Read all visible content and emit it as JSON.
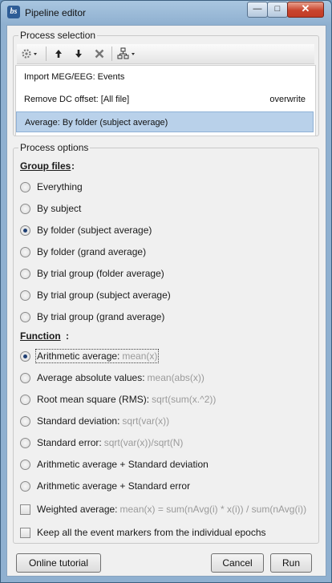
{
  "window": {
    "title": "Pipeline editor",
    "app_icon_text": "bs",
    "controls": {
      "minimize": "—",
      "maximize": "□",
      "close": "✕"
    }
  },
  "process_selection": {
    "title": "Process selection",
    "toolbar": [
      "gear-menu",
      "move-up",
      "move-down",
      "delete",
      "pipeline-tree-menu"
    ],
    "processes": [
      {
        "label": "Import MEG/EEG: Events",
        "option": ""
      },
      {
        "label": "Remove DC offset: [All file]",
        "option": "overwrite"
      },
      {
        "label": "Average: By folder (subject average)",
        "option": "",
        "selected": true
      }
    ]
  },
  "process_options": {
    "title": "Process options",
    "group_files_label": "Group files",
    "group_files_colon": ":",
    "group_files": [
      {
        "label": "Everything",
        "checked": false
      },
      {
        "label": "By subject",
        "checked": false
      },
      {
        "label": "By folder (subject average)",
        "checked": true
      },
      {
        "label": "By folder (grand average)",
        "checked": false
      },
      {
        "label": "By trial group (folder average)",
        "checked": false
      },
      {
        "label": "By trial group (subject average)",
        "checked": false
      },
      {
        "label": "By trial group (grand average)",
        "checked": false
      }
    ],
    "function_label": "Function",
    "function_colon": ":",
    "functions": [
      {
        "label": "Arithmetic average:",
        "hint": "mean(x)",
        "checked": true
      },
      {
        "label": "Average absolute values:",
        "hint": "mean(abs(x))",
        "checked": false
      },
      {
        "label": "Root mean square (RMS):",
        "hint": "sqrt(sum(x.^2))",
        "checked": false
      },
      {
        "label": "Standard deviation:",
        "hint": "sqrt(var(x))",
        "checked": false
      },
      {
        "label": "Standard error:",
        "hint": "sqrt(var(x))/sqrt(N)",
        "checked": false
      },
      {
        "label": "Arithmetic average + Standard deviation",
        "hint": "",
        "checked": false
      },
      {
        "label": "Arithmetic average + Standard error",
        "hint": "",
        "checked": false
      }
    ],
    "weighted": {
      "label": "Weighted average:",
      "hint": "mean(x) = sum(nAvg(i) * x(i)) / sum(nAvg(i))",
      "checked": false
    },
    "keep_markers": {
      "label": "Keep all the event markers from the individual epochs",
      "checked": false
    }
  },
  "buttons": {
    "tutorial": "Online tutorial",
    "cancel": "Cancel",
    "run": "Run"
  }
}
